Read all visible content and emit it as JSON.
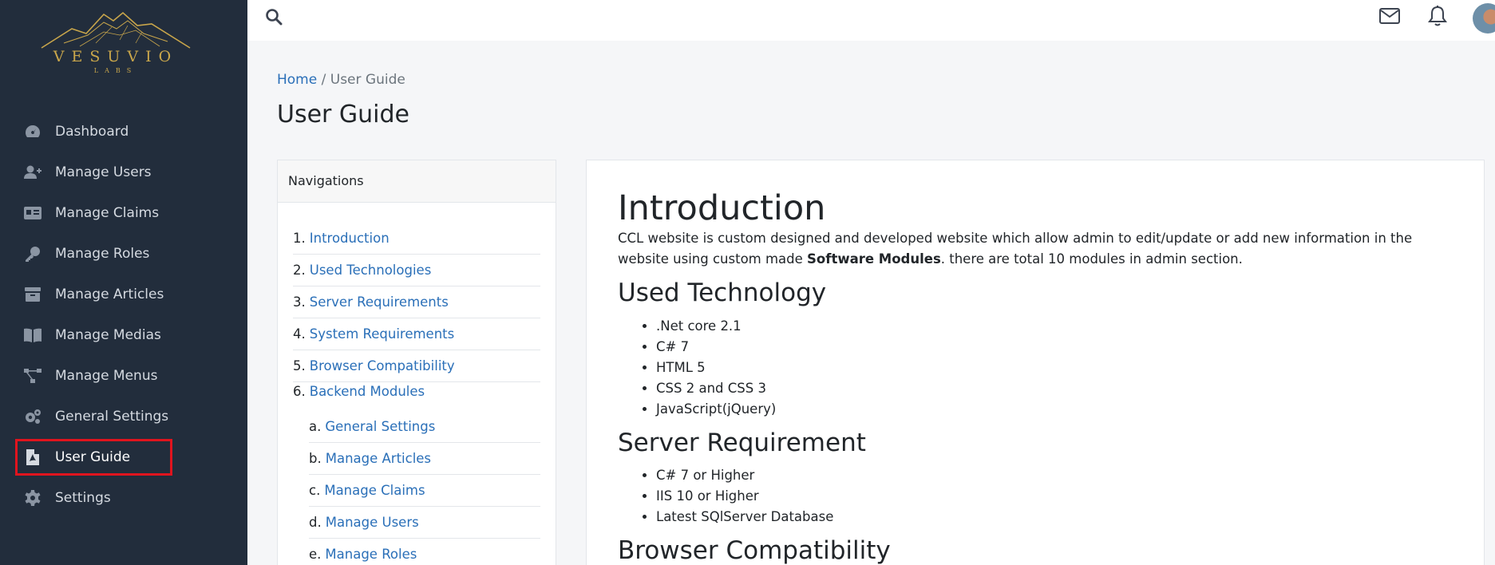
{
  "brand": {
    "name": "VESUVIO",
    "sub": "LABS"
  },
  "sidebar": {
    "items": [
      {
        "label": "Dashboard",
        "icon": "tachometer-icon"
      },
      {
        "label": "Manage Users",
        "icon": "user-plus-icon"
      },
      {
        "label": "Manage Claims",
        "icon": "id-card-icon"
      },
      {
        "label": "Manage Roles",
        "icon": "key-icon"
      },
      {
        "label": "Manage Articles",
        "icon": "archive-icon"
      },
      {
        "label": "Manage Medias",
        "icon": "book-open-icon"
      },
      {
        "label": "Manage Menus",
        "icon": "project-diagram-icon"
      },
      {
        "label": "General Settings",
        "icon": "cogs-icon"
      },
      {
        "label": "User Guide",
        "icon": "file-pdf-icon",
        "active": true
      },
      {
        "label": "Settings",
        "icon": "gear-icon"
      }
    ]
  },
  "topbar": {
    "icons": [
      "search-icon",
      "envelope-icon",
      "bell-icon",
      "avatar"
    ]
  },
  "breadcrumb": {
    "home": "Home",
    "separator": " / ",
    "current": "User Guide"
  },
  "page_title": "User Guide",
  "navigation": {
    "header": "Navigations",
    "items": [
      {
        "num": "1.",
        "label": "Introduction"
      },
      {
        "num": "2.",
        "label": "Used Technologies"
      },
      {
        "num": "3.",
        "label": "Server Requirements"
      },
      {
        "num": "4.",
        "label": "System Requirements"
      },
      {
        "num": "5.",
        "label": "Browser Compatibility"
      },
      {
        "num": "6.",
        "label": "Backend Modules"
      }
    ],
    "subitems": [
      {
        "num": "a.",
        "label": "General Settings"
      },
      {
        "num": "b.",
        "label": "Manage Articles"
      },
      {
        "num": "c.",
        "label": "Manage Claims"
      },
      {
        "num": "d.",
        "label": "Manage Users"
      },
      {
        "num": "e.",
        "label": "Manage Roles"
      }
    ]
  },
  "doc": {
    "intro_title": "Introduction",
    "intro_text_1": "CCL website is custom designed and developed website which allow admin to edit/update or add new information in the website using custom made ",
    "intro_bold": "Software Modules",
    "intro_text_2": ". there are total 10 modules in admin section.",
    "tech_title": "Used Technology",
    "tech_items": [
      ".Net core 2.1",
      "C# 7",
      "HTML 5",
      "CSS 2 and CSS 3",
      "JavaScript(jQuery)"
    ],
    "server_title": "Server Requirement",
    "server_items": [
      "C# 7 or Higher",
      "IIS 10 or Higher",
      "Latest SQlServer Database"
    ],
    "browser_title": "Browser Compatibility"
  },
  "colors": {
    "sidebar_bg": "#222d3c",
    "link": "#2a6fb8",
    "highlight": "#e0141e",
    "brand_gold": "#c9a64b"
  }
}
